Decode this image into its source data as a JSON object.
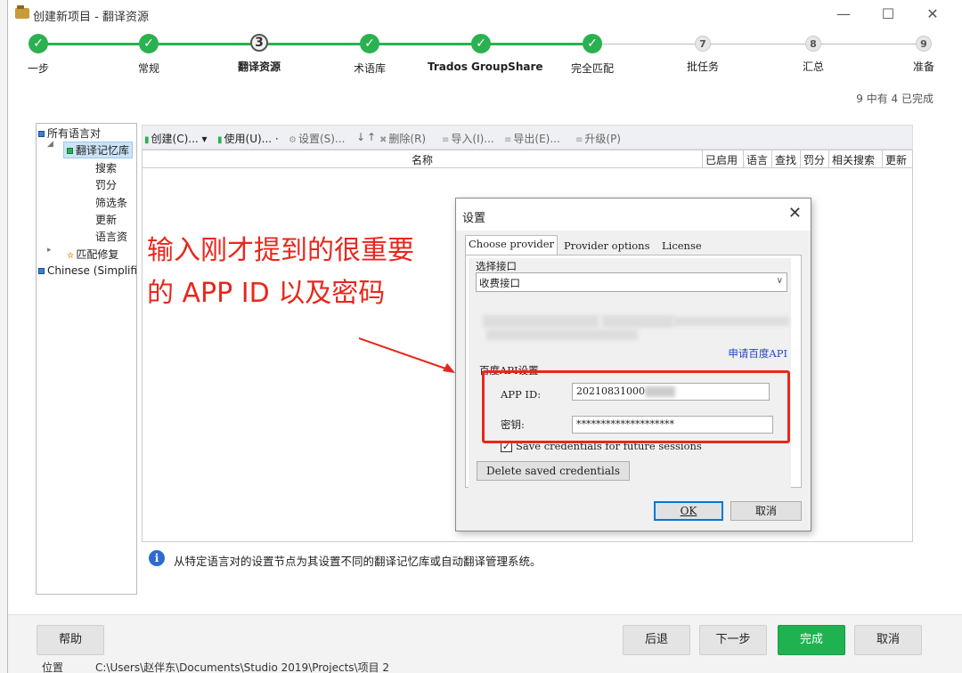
{
  "window": {
    "title": "创建新项目 - 翻译资源"
  },
  "steps": [
    {
      "label": "一步",
      "state": "done"
    },
    {
      "label": "常规",
      "state": "done"
    },
    {
      "label": "翻译资源",
      "state": "current",
      "number": "3"
    },
    {
      "label": "术语库",
      "state": "done"
    },
    {
      "label": "Trados GroupShare",
      "state": "done"
    },
    {
      "label": "完全匹配",
      "state": "done"
    },
    {
      "label": "批任务",
      "state": "todo",
      "number": "7"
    },
    {
      "label": "汇总",
      "state": "todo",
      "number": "8"
    },
    {
      "label": "准备",
      "state": "todo",
      "number": "9"
    }
  ],
  "progress_text": "9 中有 4 已完成",
  "tree": {
    "root": "所有语言对",
    "selected": "翻译记忆库",
    "children": [
      "搜索",
      "罚分",
      "筛选条",
      "更新",
      "语言资"
    ],
    "repair": "匹配修复",
    "lang": "Chinese (Simplifie"
  },
  "toolbar": {
    "create": "创建(C)...",
    "use": "使用(U)...",
    "settings": "设置(S)...",
    "delete": "删除(R)",
    "import": "导入(I)...",
    "export": "导出(E)...",
    "upgrade": "升级(P)"
  },
  "grid_columns": [
    "名称",
    "已启用",
    "语言",
    "查找",
    "罚分",
    "相关搜索",
    "更新"
  ],
  "annotation": {
    "line1": "输入刚才提到的很重要",
    "line2": "的 APP ID 以及密码"
  },
  "dialog": {
    "title": "设置",
    "tabs": [
      "Choose provider",
      "Provider options",
      "License"
    ],
    "select_label": "选择接口",
    "select_value": "收费接口",
    "apply_link": "申请百度API",
    "group_label": "百度API设置",
    "app_id_label": "APP ID:",
    "app_id_value": "20210831000",
    "secret_label": "密钥:",
    "secret_value": "********************",
    "save_checkbox_label": "Save credentials for future sessions",
    "save_checked": true,
    "delete_button": "Delete saved credentials",
    "ok": "OK",
    "cancel": "取消"
  },
  "info_text": "从特定语言对的设置节点为其设置不同的翻译记忆库或自动翻译管理系统。",
  "footer": {
    "help": "帮助",
    "back": "后退",
    "next": "下一步",
    "finish": "完成",
    "cancel": "取消"
  },
  "status": {
    "label": "位置",
    "path": "C:\\Users\\赵伴东\\Documents\\Studio 2019\\Projects\\项目 2"
  },
  "colors": {
    "accent_green": "#2ab150",
    "annotation_red": "#e8271c",
    "link_blue": "#2245c9"
  }
}
